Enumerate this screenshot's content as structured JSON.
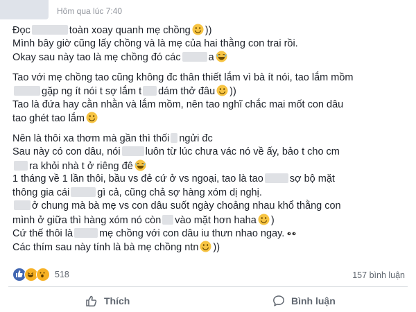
{
  "header": {
    "timestamp": "Hôm qua lúc 7:40"
  },
  "post": {
    "paragraphs": [
      [
        [
          {
            "t": "Đọc"
          },
          {
            "r": 52
          },
          {
            "t": "toàn xoay quanh mẹ chồng"
          },
          {
            "e": "smile"
          },
          {
            "t": "))"
          }
        ],
        [
          {
            "t": "Mình bây giờ cũng lấy chồng và là mẹ của hai thằng con trai rồi."
          }
        ],
        [
          {
            "t": "Okay sau này tao là mẹ chồng đó các"
          },
          {
            "r": 36
          },
          {
            "t": "a"
          },
          {
            "e": "laugh"
          }
        ]
      ],
      [
        [
          {
            "t": "Tao với mẹ chồng tao cũng không đc thân thiết lắm vì bà ít nói, tao lắm mồm"
          }
        ],
        [
          {
            "r": 38
          },
          {
            "t": "gặp ng ít nói t sợ lắm t"
          },
          {
            "r": 20
          },
          {
            "t": "dám thở đâu"
          },
          {
            "e": "smile"
          },
          {
            "t": "))"
          }
        ],
        [
          {
            "t": "Tao là đứa hay cằn nhằn và lắm mồm, nên tao nghĩ chắc mai mốt con dâu"
          }
        ],
        [
          {
            "t": "tao ghét tao lắm"
          },
          {
            "e": "smile"
          }
        ]
      ],
      [
        [
          {
            "t": "Nên là thôi xa thơm mà gần thì thối"
          },
          {
            "r": 10
          },
          {
            "t": "ngửi đc"
          }
        ],
        [
          {
            "t": "Sau này có con dâu, nói"
          },
          {
            "r": 32
          },
          {
            "t": "luôn từ lúc chưa vác nó về ấy, bảo t cho cm"
          }
        ],
        [
          {
            "r": 20
          },
          {
            "t": "ra khỏi nhà t ở riêng đê"
          },
          {
            "e": "laugh"
          }
        ],
        [
          {
            "t": "1 tháng về 1 lần thôi, bầu vs đẻ cứ ở vs ngoại, tao là tao"
          },
          {
            "r": 34
          },
          {
            "t": "sợ bộ mặt"
          }
        ],
        [
          {
            "t": "thông gia cái"
          },
          {
            "r": 36
          },
          {
            "t": "gì cả, cũng chả sợ hàng xóm dị nghị."
          }
        ],
        [
          {
            "r": 24
          },
          {
            "t": "ở chung mà bà mẹ vs con dâu suốt ngày choảng nhau khổ thằng con"
          }
        ],
        [
          {
            "t": "mình ở giữa thì hàng xóm nó còn"
          },
          {
            "r": 16
          },
          {
            "t": "vào mặt hơn haha"
          },
          {
            "e": "smile"
          },
          {
            "t": ")"
          }
        ],
        [
          {
            "t": "Cứ thế thôi là"
          },
          {
            "r": 34
          },
          {
            "t": "mẹ chồng với con dâu iu thưn nhao ngay."
          },
          {
            "e": "eyes"
          }
        ],
        [
          {
            "t": "Các thím sau này tính là bà mẹ chồng ntn"
          },
          {
            "e": "smile"
          },
          {
            "t": "))"
          }
        ]
      ]
    ]
  },
  "stats": {
    "reaction_count": "518",
    "comment_count": "157 bình luận"
  },
  "actions": {
    "like_label": "Thích",
    "comment_label": "Bình luận"
  },
  "colors": {
    "accent": "#4267b2",
    "meta_text": "#90949c",
    "action_text": "#606770",
    "emoji": "#f7c443"
  }
}
